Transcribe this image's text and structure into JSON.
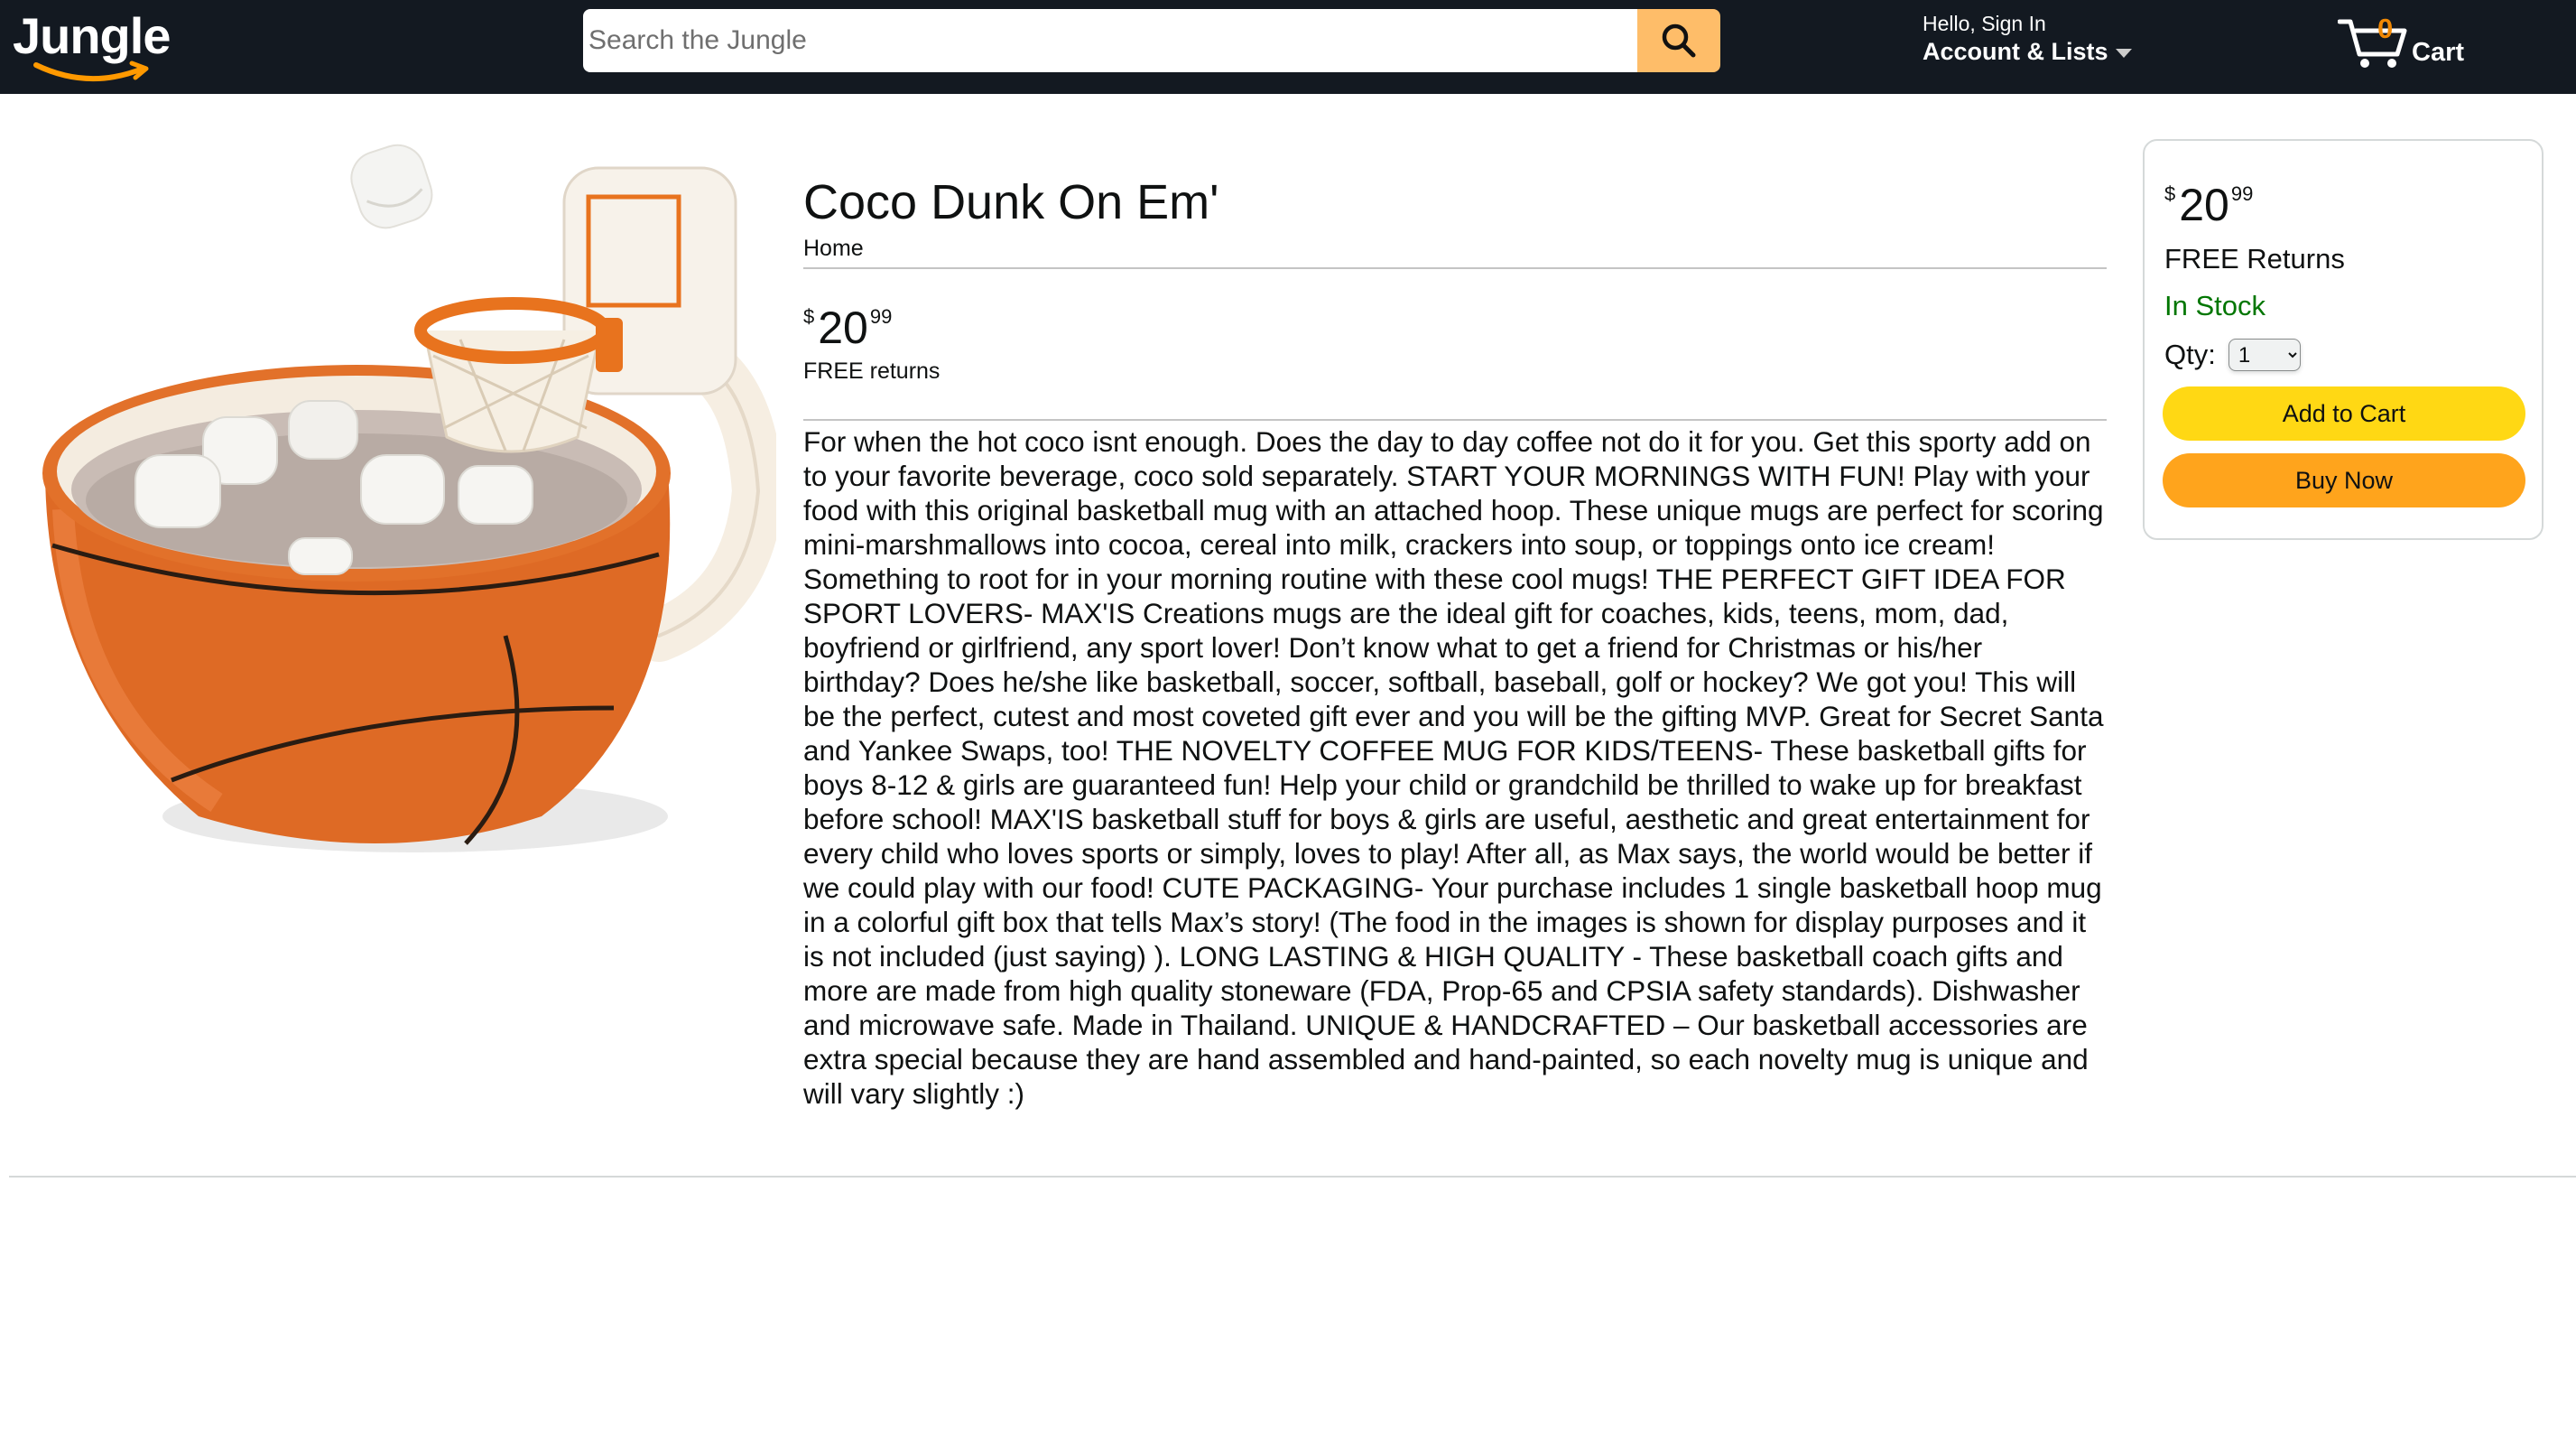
{
  "header": {
    "logo_text": "Jungle",
    "search_placeholder": "Search the Jungle",
    "search_value": "",
    "account_hello": "Hello, Sign In",
    "account_lists": "Account & Lists",
    "cart_count": "0",
    "cart_label": "Cart",
    "colors": {
      "nav_bg": "#131921",
      "search_button": "#febd69",
      "cart_count": "#f08804"
    }
  },
  "product": {
    "title": "Coco Dunk On Em'",
    "breadcrumb": "Home",
    "image_alt": "basketball mug with hoop and marshmallows",
    "price_symbol": "$",
    "price_whole": "20",
    "price_fraction": "99",
    "returns": "FREE returns",
    "description": "For when the hot coco isnt enough. Does the day to day coffee not do it for you. Get this sporty add on to your favorite beverage, coco sold separately. START YOUR MORNINGS WITH FUN! Play with your food with this original basketball mug with an attached hoop. These unique mugs are perfect for scoring mini-marshmallows into cocoa, cereal into milk, crackers into soup, or toppings onto ice cream! Something to root for in your morning routine with these cool mugs! THE PERFECT GIFT IDEA FOR SPORT LOVERS- MAX'IS Creations mugs are the ideal gift for coaches, kids, teens, mom, dad, boyfriend or girlfriend, any sport lover! Don’t know what to get a friend for Christmas or his/her birthday? Does he/she like basketball, soccer, softball, baseball, golf or hockey? We got you! This will be the perfect, cutest and most coveted gift ever and you will be the gifting MVP. Great for Secret Santa and Yankee Swaps, too! THE NOVELTY COFFEE MUG FOR KIDS/TEENS- These basketball gifts for boys 8-12 & girls are guaranteed fun! Help your child or grandchild be thrilled to wake up for breakfast before school! MAX'IS basketball stuff for boys & girls are useful, aesthetic and great entertainment for every child who loves sports or simply, loves to play! After all, as Max says, the world would be better if we could play with our food! CUTE PACKAGING- Your purchase includes 1 single basketball hoop mug in a colorful gift box that tells Max’s story! (The food in the images is shown for display purposes and it is not included (just saying) ). LONG LASTING & HIGH QUALITY - These basketball coach gifts and more are made from high quality stoneware (FDA, Prop-65 and CPSIA safety standards). Dishwasher and microwave safe. Made in Thailand. UNIQUE & HANDCRAFTED – Our basketball accessories are extra special because they are hand assembled and hand-painted, so each novelty mug is unique and will vary slightly :)"
  },
  "buybox": {
    "price_symbol": "$",
    "price_whole": "20",
    "price_fraction": "99",
    "returns": "FREE Returns",
    "stock": "In Stock",
    "qty_label": "Qty:",
    "qty_options": [
      "1"
    ],
    "qty_value": "1",
    "add_to_cart": "Add to Cart",
    "buy_now": "Buy Now",
    "colors": {
      "stock": "#007600",
      "add_to_cart": "#ffd814",
      "buy_now": "#ffa41c"
    }
  }
}
